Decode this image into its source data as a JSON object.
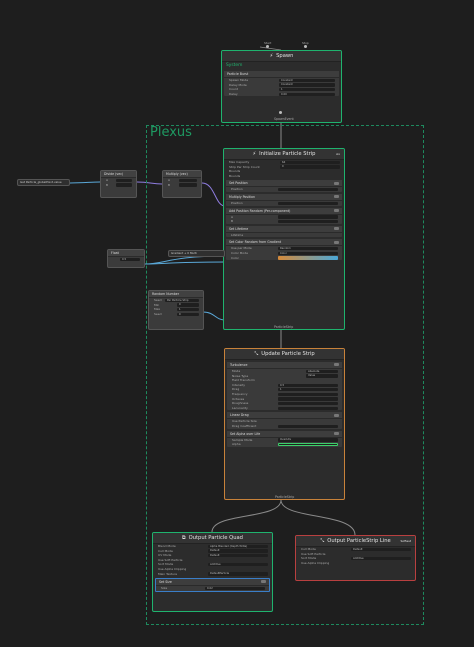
{
  "group": {
    "title": "Plexus"
  },
  "spawn": {
    "title": "Spawn",
    "in_start": "Start",
    "in_stop": "Stop",
    "system_label": "System",
    "block_title": "Particle Burst",
    "rows": [
      {
        "label": "Spawn Mode",
        "value": "Constant"
      },
      {
        "label": "Delay Mode",
        "value": "Constant"
      }
    ],
    "count_label": "Count",
    "count_value": "1",
    "delay_label": "Delay",
    "delay_value": "0.00",
    "out": "SpawnEvent"
  },
  "init": {
    "title": "Initialize Particle Strip",
    "badge": "Ax",
    "top_rows": [
      {
        "label": "Max Capacity",
        "value": "64"
      },
      {
        "label": "Strip Per Strip Count",
        "value": "0"
      }
    ],
    "bounds": [
      {
        "label": "Bounds",
        "value": ""
      },
      {
        "label": "Bounds",
        "value": ""
      }
    ],
    "blocks": [
      "Set Position",
      "Multiply Position",
      "Add Position Random (Per-component)",
      "Set Lifetime",
      "Set Color Random from Gradient"
    ],
    "pos_label": "Position",
    "mpos_label": "Position",
    "rand_rows": [
      "A",
      "B"
    ],
    "life_label": "Lifetime",
    "color_rows": [
      {
        "label": "Use per Mode",
        "value": "Random"
      },
      {
        "label": "Color Mode",
        "value": "Color"
      }
    ],
    "color_label": "Color",
    "out": "ParticleStrip"
  },
  "update": {
    "title": "Update Particle Strip",
    "block1": "Turbulence",
    "b1_rows": [
      {
        "label": "Mode",
        "value": "Absolute"
      },
      {
        "label": "Noise Type",
        "value": "Value"
      }
    ],
    "b1_sub": [
      "Field Transform",
      "Intensity",
      "Drag",
      "Frequency",
      "Octaves",
      "Roughness",
      "Lacunarity"
    ],
    "b1_vals": [
      "",
      "0.5",
      "1",
      "",
      "",
      "",
      ""
    ],
    "block2": "Linear Drag",
    "b2_rows": [
      "Use Particle Size",
      "Drag Coefficient"
    ],
    "block3": "Set Alpha over Life",
    "b3_rows": [
      {
        "label": "Sample Mode",
        "value": "OverLife"
      }
    ],
    "alpha_label": "Alpha",
    "out": "ParticleStrip"
  },
  "outQuad": {
    "title": "Output Particle Quad",
    "rows": [
      {
        "label": "Blend Mode",
        "value": "Alpha Blended (Depth Write)"
      },
      {
        "label": "Cull Mode",
        "value": "Default"
      },
      {
        "label": "UV Mode",
        "value": "Default"
      },
      {
        "label": "Use Soft Particle",
        "value": ""
      },
      {
        "label": "Sort Mode",
        "value": "Additive"
      },
      {
        "label": "Use Alpha Clipping",
        "value": ""
      }
    ],
    "tex_label": "Main Texture",
    "tex_value": "DefaultParticle",
    "block": "Set Size",
    "size_label": "Size",
    "size_value": "0.02"
  },
  "outLine": {
    "title": "Output ParticleStrip Line",
    "badge": "Softest",
    "rows": [
      {
        "label": "Cull Mode",
        "value": "Default"
      },
      {
        "label": "Use Soft Particle",
        "value": ""
      },
      {
        "label": "Sort Mode",
        "value": "Additive"
      },
      {
        "label": "Use Alpha Clipping",
        "value": ""
      }
    ]
  },
  "nodes": {
    "prop": {
      "label": "Get Particle_globalPoint.value"
    },
    "divide": {
      "title": "Divide (vec)",
      "ports": [
        "A",
        "B"
      ]
    },
    "mult": {
      "title": "Multiply (vec)",
      "ports": [
        "A",
        "B"
      ]
    },
    "float": {
      "title": "Float",
      "value": "0.5"
    },
    "gradient": {
      "label": "Gradient + 0 Multi"
    },
    "rand": {
      "title": "Random Number",
      "seed_label": "Seed",
      "seed_value": "Per Particle Strip",
      "rows": [
        {
          "label": "Min",
          "value": "0"
        },
        {
          "label": "Max",
          "value": "1"
        },
        {
          "label": "Seed",
          "value": "0"
        }
      ]
    }
  },
  "colors": {
    "green": "#1fb36e",
    "orange": "#c8823a",
    "blue": "#3a7ec8",
    "red": "#b94040",
    "wire_flow": "#8a8a8a",
    "wire_float": "#5aa8d8",
    "wire_vec": "#8f7de0"
  }
}
